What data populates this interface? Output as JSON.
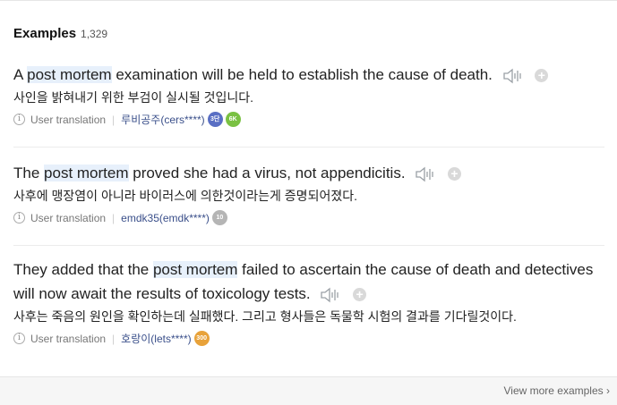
{
  "header": {
    "title": "Examples",
    "count": "1,329"
  },
  "examples": [
    {
      "en_before": "A ",
      "en_highlight": "post mortem",
      "en_after": " examination will be held to establish the cause of death.",
      "ko": "사인을 밝혀내기 위한 부검이 실시될 것입니다.",
      "source": "User translation",
      "user": "루비공주(cers****)",
      "badges": [
        {
          "text": "3단",
          "color": "#5a6fc4"
        },
        {
          "text": "6K",
          "color": "#7ac143"
        }
      ]
    },
    {
      "en_before": "The ",
      "en_highlight": "post mortem",
      "en_after": " proved she had a virus, not appendicitis.",
      "ko": "사후에 맹장염이 아니라 바이러스에 의한것이라는게 증명되어졌다.",
      "source": "User translation",
      "user": "emdk35(emdk****)",
      "badges": [
        {
          "text": "10",
          "color": "#b5b5b5"
        }
      ]
    },
    {
      "en_before": "They added that the ",
      "en_highlight": "post mortem",
      "en_after": " failed to ascertain the cause of death and detectives will now await the results of toxicology tests.",
      "ko": "사후는 죽음의 원인을 확인하는데 실패했다. 그리고 형사들은 독물학 시험의 결과를 기다릴것이다.",
      "source": "User translation",
      "user": "호랑이(lets****)",
      "badges": [
        {
          "text": "300",
          "color": "#e8a23a"
        }
      ]
    }
  ],
  "footer": {
    "more_label": "View more examples"
  },
  "icons": {
    "speaker": "speaker-icon",
    "add": "plus-icon",
    "info": "info-icon",
    "chevron": "chevron-right-icon"
  }
}
